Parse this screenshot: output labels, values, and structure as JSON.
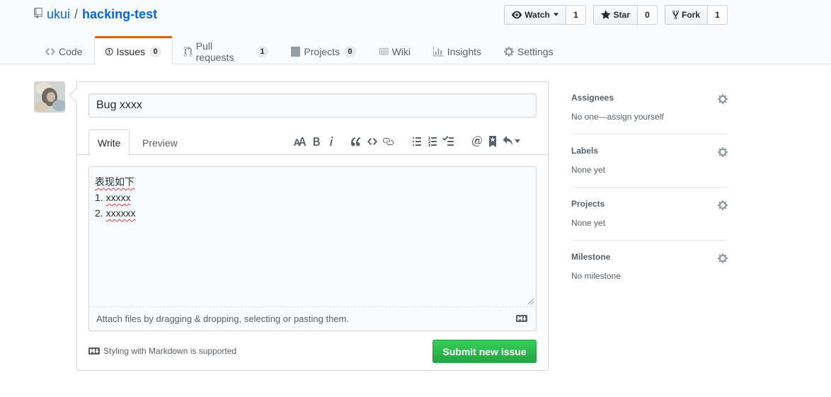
{
  "repo": {
    "owner": "ukui",
    "separator": "/",
    "name": "hacking-test"
  },
  "actions": {
    "watch_label": "Watch",
    "watch_count": "1",
    "star_label": "Star",
    "star_count": "0",
    "fork_label": "Fork",
    "fork_count": "1"
  },
  "nav": {
    "code": "Code",
    "issues": "Issues",
    "issues_count": "0",
    "pulls": "Pull requests",
    "pulls_count": "1",
    "projects": "Projects",
    "projects_count": "0",
    "wiki": "Wiki",
    "insights": "Insights",
    "settings": "Settings"
  },
  "form": {
    "title_value": "Bug xxxx",
    "tab_write": "Write",
    "tab_preview": "Preview",
    "body_lines": [
      "表现如下",
      "1. ",
      "xxxxx",
      "2. ",
      "xxxxxx"
    ],
    "drag_hint": "Attach files by dragging & dropping, selecting or pasting them.",
    "markdown_hint": "Styling with Markdown is supported",
    "submit_label": "Submit new issue"
  },
  "sidebar": {
    "assignees_heading": "Assignees",
    "assignees_value": "No one—assign yourself",
    "labels_heading": "Labels",
    "labels_value": "None yet",
    "projects_heading": "Projects",
    "projects_value": "None yet",
    "milestone_heading": "Milestone",
    "milestone_value": "No milestone"
  },
  "colors": {
    "link": "#0366d6",
    "accent_tab": "#e36209",
    "primary_button": "#28a745"
  }
}
